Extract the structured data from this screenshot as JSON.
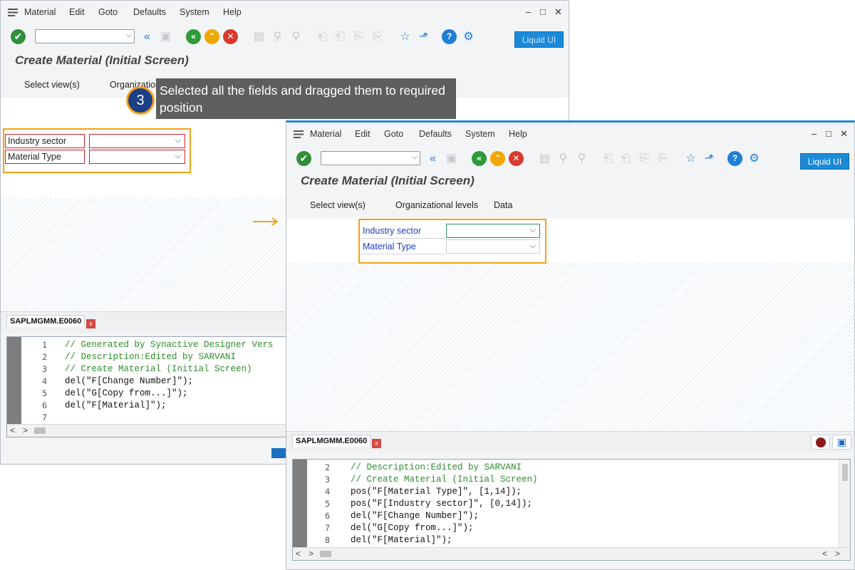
{
  "menu": [
    "Material",
    "Edit",
    "Goto",
    "Defaults",
    "System",
    "Help"
  ],
  "window_controls": [
    "–",
    "□",
    "✕"
  ],
  "toolbar": {
    "liquid_ui_label": "Liquid UI",
    "ok_symbol": "✔"
  },
  "screen": {
    "title": "Create Material (Initial Screen)",
    "appbar_back": [
      "Select view(s)",
      "Organization"
    ],
    "appbar_front": [
      "Select view(s)",
      "Organizational levels",
      "Data"
    ]
  },
  "fields": {
    "industry_sector": "Industry sector",
    "material_type": "Material Type"
  },
  "annotation": {
    "step": "3",
    "text": "Selected all the fields and dragged them to required position"
  },
  "editor_back": {
    "tab": "SAPLMGMM.E0060",
    "lines": [
      {
        "n": "1",
        "code": "// Generated by Synactive Designer Vers",
        "comment": true
      },
      {
        "n": "2",
        "code": "// Description:Edited by SARVANI",
        "comment": true
      },
      {
        "n": "3",
        "code": "// Create Material (Initial Screen)",
        "comment": true
      },
      {
        "n": "4",
        "code": "del(\"F[Change Number]\");",
        "comment": false
      },
      {
        "n": "5",
        "code": "del(\"G[Copy from...]\");",
        "comment": false
      },
      {
        "n": "6",
        "code": "del(\"F[Material]\");",
        "comment": false
      },
      {
        "n": "7",
        "code": "",
        "comment": false
      }
    ]
  },
  "editor_front": {
    "tab": "SAPLMGMM.E0060",
    "lines": [
      {
        "n": "2",
        "code": "// Description:Edited by SARVANI",
        "comment": true
      },
      {
        "n": "3",
        "code": "// Create Material (Initial Screen)",
        "comment": true
      },
      {
        "n": "4",
        "code": "pos(\"F[Material Type]\", [1,14]);",
        "comment": false
      },
      {
        "n": "5",
        "code": "pos(\"F[Industry sector]\", [0,14]);",
        "comment": false
      },
      {
        "n": "6",
        "code": "del(\"F[Change Number]\");",
        "comment": false
      },
      {
        "n": "7",
        "code": "del(\"G[Copy from...]\");",
        "comment": false
      },
      {
        "n": "8",
        "code": "del(\"F[Material]\");",
        "comment": false
      }
    ]
  },
  "scroll_arrows": [
    "<",
    ">"
  ],
  "colors": {
    "accent_orange": "#f4a21a",
    "sap_blue": "#1b8ad8",
    "field_label_blue": "#1a3fbf",
    "badge_navy": "#1d3f86"
  }
}
